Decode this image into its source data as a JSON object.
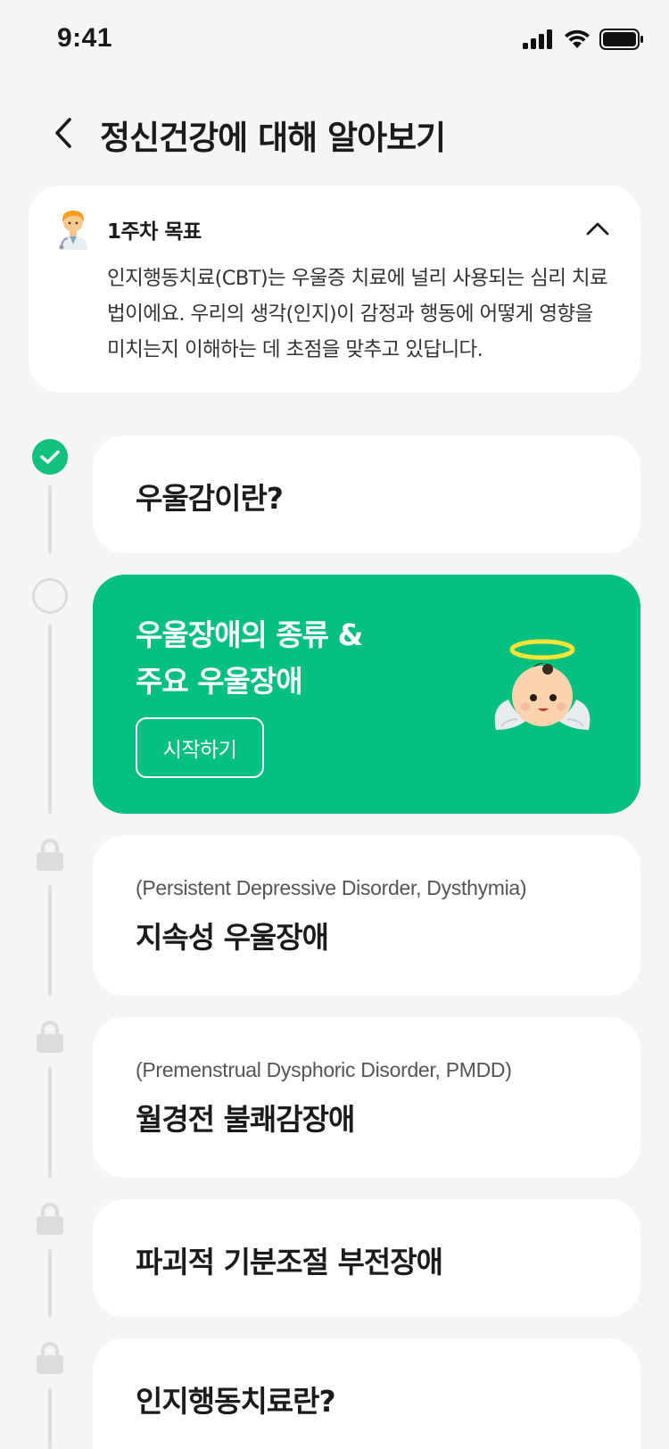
{
  "status_bar": {
    "time": "9:41"
  },
  "header": {
    "title": "정신건강에 대해 알아보기"
  },
  "goal": {
    "label": "1주차 목표",
    "description": "인지행동치료(CBT)는 우울증 치료에 널리 사용되는 심리 치료법이에요. 우리의 생각(인지)이 감정과 행동에 어떻게 영향을 미치는지 이해하는 데 초점을 맞추고 있답니다."
  },
  "lessons": [
    {
      "title": "우울감이란?",
      "status": "completed"
    },
    {
      "title_line1": "우울장애의 종류 &",
      "title_line2": "주요 우울장애",
      "status": "current",
      "button_label": "시작하기"
    },
    {
      "subtitle": "(Persistent Depressive Disorder, Dysthymia)",
      "title": "지속성 우울장애",
      "status": "locked"
    },
    {
      "subtitle": "(Premenstrual Dysphoric Disorder, PMDD)",
      "title": "월경전 불쾌감장애",
      "status": "locked"
    },
    {
      "title": "파괴적 기분조절 부전장애",
      "status": "locked"
    },
    {
      "title": "인지행동치료란?",
      "status": "locked"
    }
  ],
  "colors": {
    "accent": "#06c07f",
    "check": "#12c17d",
    "background": "#f5f5f5",
    "lock": "#dcdcdc"
  },
  "icons": [
    "back-arrow-icon",
    "chevron-up-icon",
    "doctor-avatar-icon",
    "check-icon",
    "lock-icon",
    "angel-baby-icon",
    "signal-icon",
    "wifi-icon",
    "battery-icon"
  ]
}
